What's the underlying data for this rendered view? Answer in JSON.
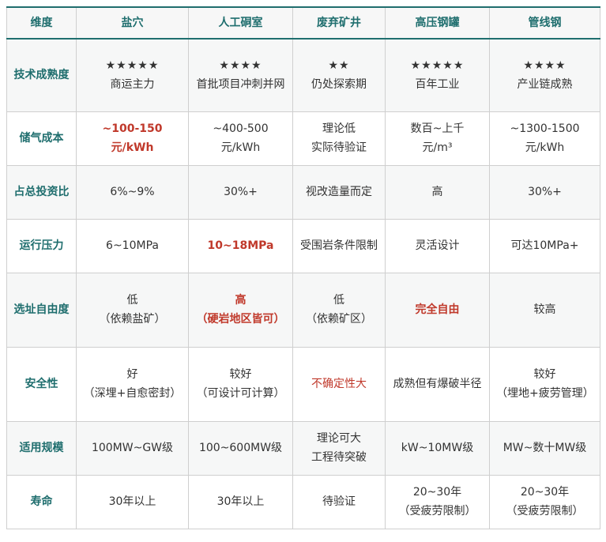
{
  "headers": [
    "维度",
    "盐穴",
    "人工硐室",
    "废弃矿井",
    "高压钢罐",
    "管线钢"
  ],
  "rows": [
    {
      "label": "技术成熟度",
      "cells": [
        {
          "line1": "★★★★★",
          "line2": "商运主力"
        },
        {
          "line1": "★★★★",
          "line2": "首批项目冲刺并网"
        },
        {
          "line1": "★★",
          "line2": "仍处探索期"
        },
        {
          "line1": "★★★★★",
          "line2": "百年工业"
        },
        {
          "line1": "★★★★",
          "line2": "产业链成熟"
        }
      ]
    },
    {
      "label": "储气成本",
      "cells": [
        {
          "line1": "~100-150",
          "line2": "元/kWh"
        },
        {
          "line1": "~400-500",
          "line2": "元/kWh"
        },
        {
          "line1": "理论低",
          "line2": "实际待验证"
        },
        {
          "line1": "数百~上千",
          "line2": "元/m³"
        },
        {
          "line1": "~1300-1500",
          "line2": "元/kWh"
        }
      ]
    },
    {
      "label": "占总投资比",
      "cells": [
        {
          "line1": "6%~9%"
        },
        {
          "line1": "30%+"
        },
        {
          "line1": "视改造量而定"
        },
        {
          "line1": "高"
        },
        {
          "line1": "30%+"
        }
      ]
    },
    {
      "label": "运行压力",
      "cells": [
        {
          "line1": "6~10MPa"
        },
        {
          "line1": "10~18MPa"
        },
        {
          "line1": "受围岩条件限制"
        },
        {
          "line1": "灵活设计"
        },
        {
          "line1": "可达10MPa+"
        }
      ]
    },
    {
      "label": "选址自由度",
      "cells": [
        {
          "line1": "低",
          "line2": "（依赖盐矿）"
        },
        {
          "line1": "高",
          "line2": "（硬岩地区皆可）"
        },
        {
          "line1": "低",
          "line2": "（依赖矿区）"
        },
        {
          "line1": "完全自由"
        },
        {
          "line1": "较高"
        }
      ]
    },
    {
      "label": "安全性",
      "cells": [
        {
          "line1": "好",
          "line2": "（深埋+自愈密封）"
        },
        {
          "line1": "较好",
          "line2": "（可设计可计算）"
        },
        {
          "line1": "不确定性大"
        },
        {
          "line1": "成熟但有爆破半径"
        },
        {
          "line1": "较好",
          "line2": "（埋地+疲劳管理）"
        }
      ]
    },
    {
      "label": "适用规模",
      "cells": [
        {
          "line1": "100MW~GW级"
        },
        {
          "line1": "100~600MW级"
        },
        {
          "line1": "理论可大",
          "line2": "工程待突破"
        },
        {
          "line1": "kW~10MW级"
        },
        {
          "line1": "MW~数十MW级"
        }
      ]
    },
    {
      "label": "寿命",
      "cells": [
        {
          "line1": "30年以上"
        },
        {
          "line1": "30年以上"
        },
        {
          "line1": "待验证"
        },
        {
          "line1": "20~30年",
          "line2": "（受疲劳限制）"
        },
        {
          "line1": "20~30年",
          "line2": "（受疲劳限制）"
        }
      ]
    }
  ]
}
